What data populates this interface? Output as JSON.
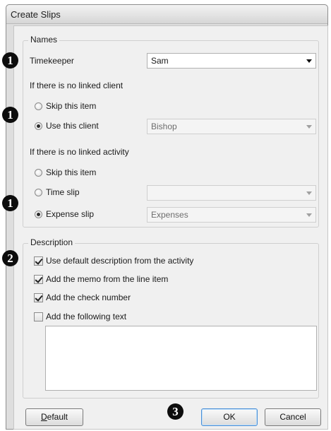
{
  "window": {
    "title": "Create Slips"
  },
  "names": {
    "legend": "Names",
    "timekeeper": {
      "label": "Timekeeper",
      "value": "Sam"
    },
    "client": {
      "heading": "If there is no linked client",
      "options": [
        {
          "label": "Skip this item",
          "checked": false
        },
        {
          "label": "Use this client",
          "checked": true
        }
      ],
      "combo_value": "Bishop"
    },
    "activity": {
      "heading": "If there is no linked activity",
      "options": [
        {
          "label": "Skip this item",
          "checked": false
        },
        {
          "label": "Time slip",
          "checked": false
        },
        {
          "label": "Expense slip",
          "checked": true
        }
      ],
      "time_combo_value": "",
      "expense_combo_value": "Expenses"
    }
  },
  "description": {
    "legend": "Description",
    "options": [
      {
        "label": "Use default description from the activity",
        "checked": true
      },
      {
        "label": "Add the memo from the line item",
        "checked": true
      },
      {
        "label": "Add the check number",
        "checked": true
      },
      {
        "label": "Add the following text",
        "checked": false
      }
    ],
    "text_value": ""
  },
  "buttons": {
    "default": "Default",
    "default_mnemonic": "D",
    "default_rest": "efault",
    "ok": "OK",
    "cancel": "Cancel"
  },
  "callouts": [
    "1",
    "1",
    "1",
    "2",
    "3"
  ]
}
